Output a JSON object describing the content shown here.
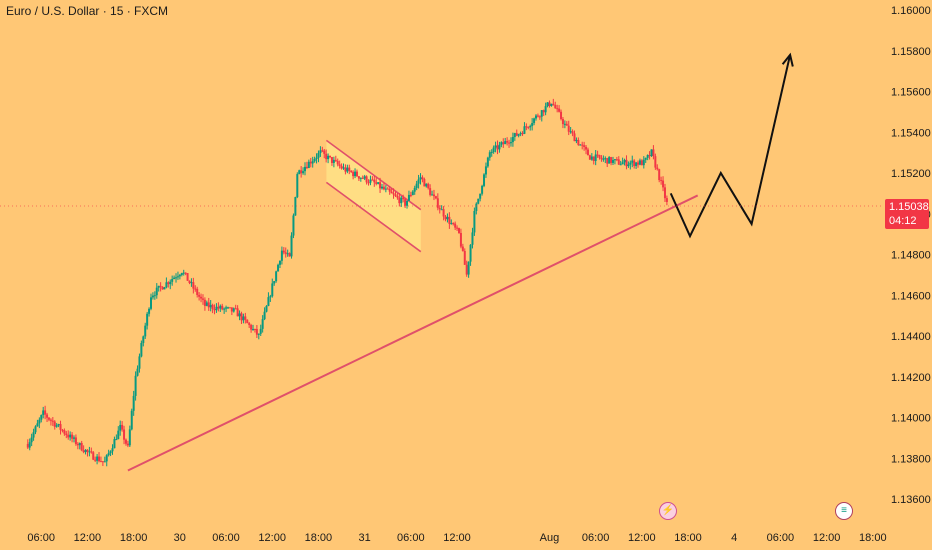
{
  "symbol_title": "Euro / U.S. Dollar · 15 · FXCM",
  "price_axis_ticks": [
    "1.16000",
    "1.15800",
    "1.15600",
    "1.15400",
    "1.15200",
    "1.15000",
    "1.14800",
    "1.14600",
    "1.14400",
    "1.14200",
    "1.14000",
    "1.13800",
    "1.13600"
  ],
  "time_axis_ticks": [
    "06:00",
    "12:00",
    "18:00",
    "30",
    "06:00",
    "12:00",
    "18:00",
    "31",
    "06:00",
    "12:00",
    "Aug",
    "06:00",
    "12:00",
    "18:00",
    "4",
    "06:00",
    "12:00",
    "18:00"
  ],
  "current_price": {
    "price": "1.15038",
    "countdown": "04:12"
  },
  "colors": {
    "background": "#ffc775",
    "up": "#089981",
    "down": "#f23645",
    "trendline": "#e0506a",
    "projection": "#111111",
    "flag_fill": "#ffe58a"
  },
  "chart_data": {
    "type": "candlestick",
    "title": "Euro / U.S. Dollar · 15 · FXCM",
    "xlabel": "",
    "ylabel": "",
    "ylim": [
      1.1355,
      1.1612
    ],
    "price_path": [
      [
        "Jul 29 04:00",
        1.1387
      ],
      [
        "Jul 29 06:00",
        1.1402
      ],
      [
        "Jul 29 09:00",
        1.1392
      ],
      [
        "Jul 29 12:00",
        1.1382
      ],
      [
        "Jul 29 14:00",
        1.1378
      ],
      [
        "Jul 29 16:00",
        1.1395
      ],
      [
        "Jul 29 17:00",
        1.1385
      ],
      [
        "Jul 29 18:00",
        1.142
      ],
      [
        "Jul 29 20:00",
        1.146
      ],
      [
        "Jul 30 00:00",
        1.1472
      ],
      [
        "Jul 30 03:00",
        1.1455
      ],
      [
        "Jul 30 07:00",
        1.1452
      ],
      [
        "Jul 30 10:00",
        1.144
      ],
      [
        "Jul 30 13:00",
        1.1482
      ],
      [
        "Jul 30 14:00",
        1.1478
      ],
      [
        "Jul 30 15:00",
        1.152
      ],
      [
        "Jul 30 18:00",
        1.153
      ],
      [
        "Jul 30 21:00",
        1.1522
      ],
      [
        "Jul 31 01:00",
        1.1515
      ],
      [
        "Jul 31 05:00",
        1.1505
      ],
      [
        "Jul 31 07:00",
        1.1518
      ],
      [
        "Jul 31 10:00",
        1.15
      ],
      [
        "Jul 31 12:00",
        1.149
      ],
      [
        "Jul 31 13:00",
        1.147
      ],
      [
        "Jul 31 14:00",
        1.15
      ],
      [
        "Jul 31 16:00",
        1.153
      ],
      [
        "Jul 31 20:00",
        1.154
      ],
      [
        "Aug 1 00:00",
        1.1555
      ],
      [
        "Aug 1 02:00",
        1.1542
      ],
      [
        "Aug 1 05:00",
        1.1528
      ],
      [
        "Aug 1 09:00",
        1.1525
      ],
      [
        "Aug 1 12:00",
        1.1525
      ],
      [
        "Aug 1 13:00",
        1.153
      ],
      [
        "Aug 1 14:00",
        1.1518
      ],
      [
        "Aug 1 15:00",
        1.1505
      ]
    ],
    "price_high": 1.156,
    "price_low": 1.1378,
    "annotations": {
      "trendline": {
        "from": [
          "Jul 29 17:00",
          1.1374
        ],
        "to": [
          "Aug 1 19:00",
          1.1509
        ]
      },
      "flag_channel": {
        "from": [
          "Jul 30 18:00",
          1.1536
        ],
        "to": [
          "Jul 31 06:00",
          1.1502
        ]
      },
      "projection_path": [
        [
          "Aug 1 15:30",
          1.151
        ],
        [
          "Aug 1 18:00",
          1.1489
        ],
        [
          "Aug 1 22:00",
          1.152
        ],
        [
          "Aug 2 02:00",
          1.1495
        ],
        [
          "Aug 2 07:00",
          1.1578
        ]
      ]
    }
  }
}
